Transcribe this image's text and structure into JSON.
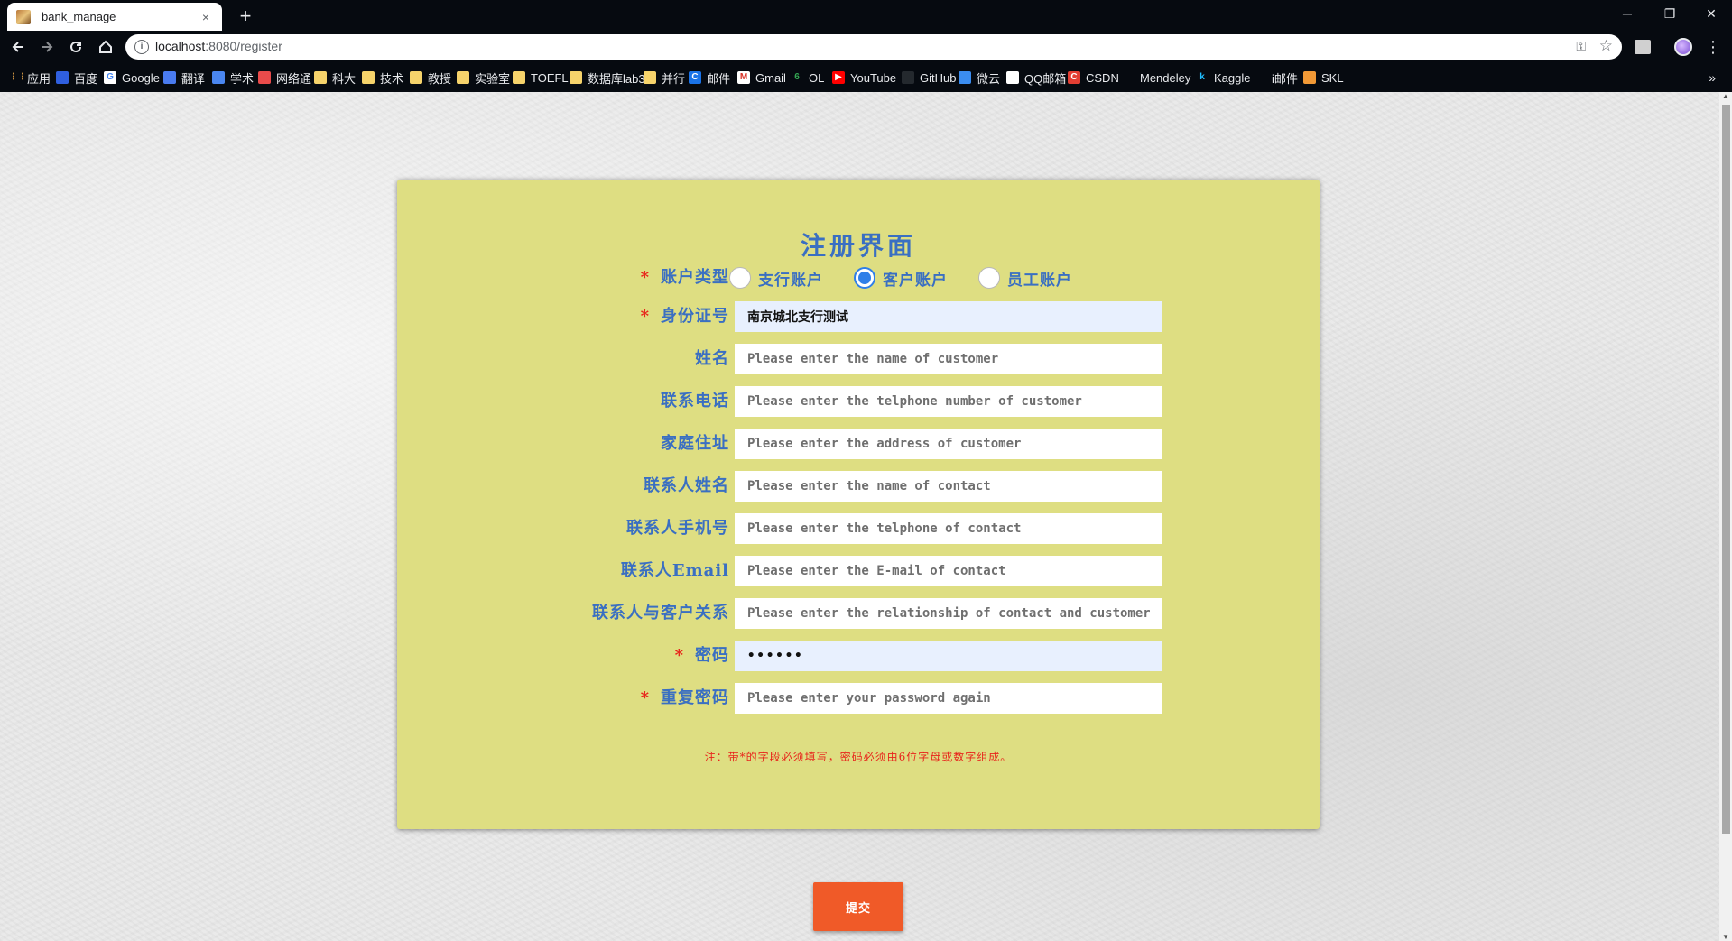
{
  "browser": {
    "tab_title": "bank_manage",
    "tab_close": "×",
    "new_tab": "+",
    "url_host": "localhost",
    "url_rest": ":8080/register",
    "win_min": "─",
    "win_restore": "❐",
    "win_close": "✕"
  },
  "bookmarks": [
    {
      "label": "应用",
      "icon": "apps-grid-icon"
    },
    {
      "label": "百度",
      "icon": "baidu-icon"
    },
    {
      "label": "Google",
      "icon": "google-icon"
    },
    {
      "label": "翻译",
      "icon": "translate-icon"
    },
    {
      "label": "学术",
      "icon": "scholar-icon"
    },
    {
      "label": "网络通",
      "icon": "network-icon"
    },
    {
      "label": "科大",
      "icon": "folder-icon"
    },
    {
      "label": "技术",
      "icon": "folder-icon"
    },
    {
      "label": "教授",
      "icon": "folder-icon"
    },
    {
      "label": "实验室",
      "icon": "folder-icon"
    },
    {
      "label": "TOEFL",
      "icon": "folder-icon"
    },
    {
      "label": "数据库lab3",
      "icon": "folder-icon"
    },
    {
      "label": "并行",
      "icon": "folder-icon"
    },
    {
      "label": "邮件",
      "icon": "mail-icon"
    },
    {
      "label": "Gmail",
      "icon": "gmail-icon"
    },
    {
      "label": "OL",
      "icon": "ol-icon"
    },
    {
      "label": "YouTube",
      "icon": "youtube-icon"
    },
    {
      "label": "GitHub",
      "icon": "github-icon"
    },
    {
      "label": "微云",
      "icon": "weiyun-icon"
    },
    {
      "label": "QQ邮箱",
      "icon": "qqmail-icon"
    },
    {
      "label": "CSDN",
      "icon": "csdn-icon"
    },
    {
      "label": "Mendeley",
      "icon": "mendeley-icon"
    },
    {
      "label": "Kaggle",
      "icon": "kaggle-icon"
    },
    {
      "label": "i邮件",
      "icon": "apple-icon"
    },
    {
      "label": "SKL",
      "icon": "skl-icon"
    }
  ],
  "bookmarks_more": "»",
  "form": {
    "title": "注册界面",
    "account_type_label": "账户类型",
    "required_mark": "*",
    "account_types": [
      {
        "label": "支行账户",
        "checked": false
      },
      {
        "label": "客户账户",
        "checked": true
      },
      {
        "label": "员工账户",
        "checked": false
      }
    ],
    "id_label": "身份证号",
    "id_value": "南京城北支行测试",
    "name_label": "姓名",
    "name_placeholder": "Please enter the name of customer",
    "phone_label": "联系电话",
    "phone_placeholder": "Please enter the telphone number of customer",
    "address_label": "家庭住址",
    "address_placeholder": "Please enter the address of customer",
    "contact_name_label": "联系人姓名",
    "contact_name_placeholder": "Please enter the name of contact",
    "contact_phone_label": "联系人手机号",
    "contact_phone_placeholder": "Please enter the telphone of contact",
    "contact_email_label": "联系人Email",
    "contact_email_placeholder": "Please enter the E-mail of contact",
    "relation_label": "联系人与客户关系",
    "relation_placeholder": "Please enter the relationship of contact and customer",
    "password_label": "密码",
    "password_value": "••••••",
    "repeat_label": "重复密码",
    "repeat_placeholder": "Please enter your password again",
    "note": "注：带*的字段必须填写，密码必须由6位字母或数字组成。",
    "submit": "提交"
  },
  "colors": {
    "card_bg": "#dede82",
    "label_blue": "#3a6fc2",
    "required_red": "#e8241b",
    "submit_orange": "#f05a28",
    "radio_blue": "#2f7fe8"
  }
}
